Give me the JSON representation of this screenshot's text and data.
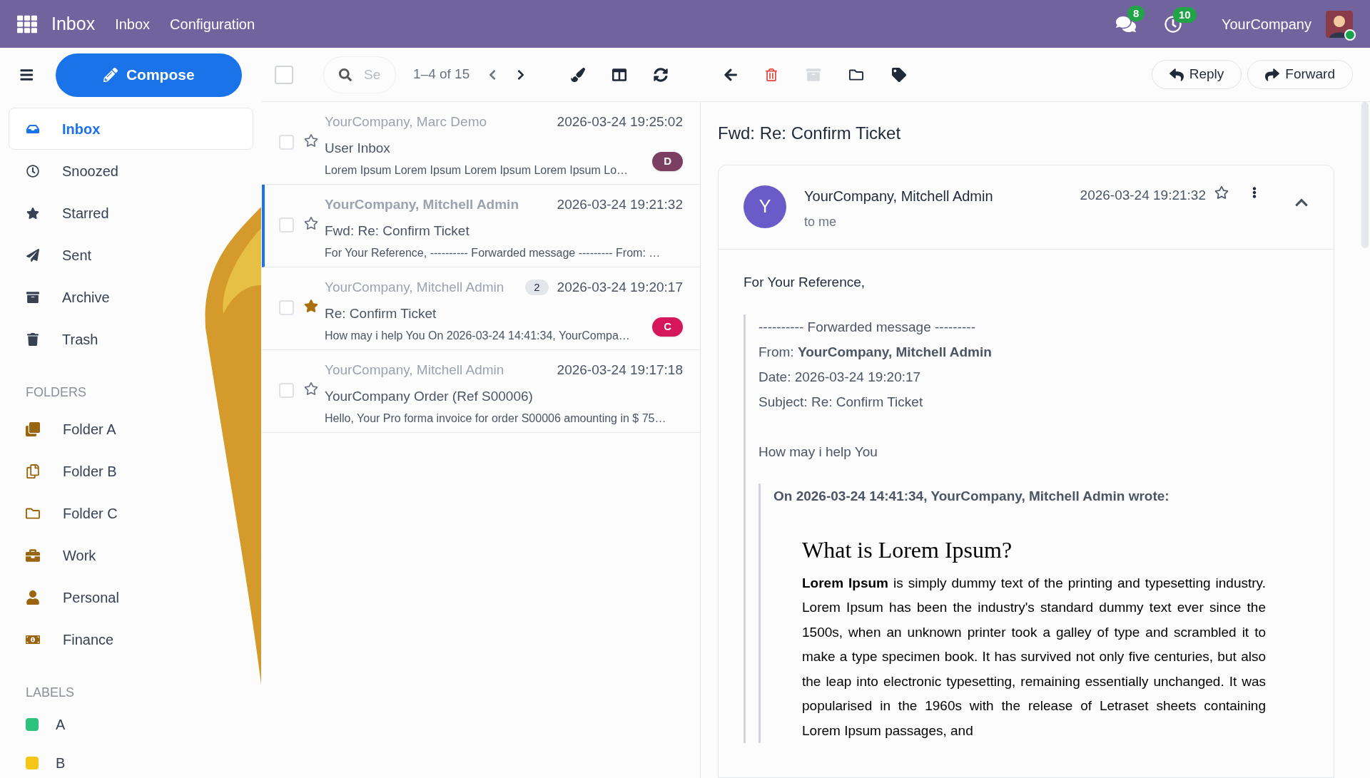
{
  "topbar": {
    "app": "Inbox",
    "menu": [
      "Inbox",
      "Configuration"
    ],
    "messages_badge": "8",
    "activities_badge": "10",
    "company": "YourCompany",
    "online": true
  },
  "toolbar": {
    "compose": "Compose",
    "select_all": {
      "checked": false
    },
    "search": {
      "placeholder": "Se"
    },
    "pager": "1–4 of 15",
    "reply": "Reply",
    "forward": "Forward"
  },
  "sidebar": {
    "mailboxes": [
      {
        "label": "Inbox",
        "selected": true
      },
      {
        "label": "Snoozed",
        "selected": false
      },
      {
        "label": "Starred",
        "selected": false
      },
      {
        "label": "Sent",
        "selected": false
      },
      {
        "label": "Archive",
        "selected": false
      },
      {
        "label": "Trash",
        "selected": false
      }
    ],
    "folders_heading": "FOLDERS",
    "folders": [
      {
        "label": "Folder A"
      },
      {
        "label": "Folder B"
      },
      {
        "label": "Folder C"
      },
      {
        "label": "Work"
      },
      {
        "label": "Personal"
      },
      {
        "label": "Finance"
      }
    ],
    "labels_heading": "LABELS",
    "labels": [
      {
        "label": "A",
        "color": "#2ec27e"
      },
      {
        "label": "B",
        "color": "#f5c518"
      }
    ]
  },
  "messages": [
    {
      "sender": "YourCompany, Marc Demo",
      "date": "2026-03-24 19:25:02",
      "subject": "User Inbox",
      "preview": "Lorem Ipsum Lorem Ipsum Lorem Ipsum Lorem Ipsum Lo…",
      "tag": "D",
      "color": "#7b3f61",
      "selected": false,
      "unread": false,
      "starred": false,
      "checked": false
    },
    {
      "sender": "YourCompany, Mitchell Admin",
      "date": "2026-03-24 19:21:32",
      "subject": "Fwd: Re: Confirm Ticket",
      "preview": "For Your Reference, ---------- Forwarded message --------- From: …",
      "selected": true,
      "unread": true,
      "starred": false,
      "checked": false
    },
    {
      "sender": "YourCompany, Mitchell Admin",
      "count": "2",
      "date": "2026-03-24 19:20:17",
      "subject": "Re: Confirm Ticket",
      "preview": "How may i help You On 2026-03-24 14:41:34, YourCompa…",
      "tag": "C",
      "color": "#d6165a",
      "selected": false,
      "unread": false,
      "starred": true,
      "checked": false
    },
    {
      "sender": "YourCompany, Mitchell Admin",
      "date": "2026-03-24 19:17:18",
      "subject": "YourCompany Order (Ref S00006)",
      "preview": "Hello, Your Pro forma invoice for order S00006 amounting in $ 75…",
      "selected": false,
      "unread": false,
      "starred": false,
      "checked": false
    }
  ],
  "reader": {
    "subject": "Fwd: Re: Confirm Ticket",
    "avatar": "Y",
    "sender": "YourCompany, Mitchell Admin",
    "recipient": "to me",
    "date": "2026-03-24 19:21:32",
    "starred": false,
    "greeting": "For Your Reference,",
    "forwarded": [
      "---------- Forwarded message ---------",
      "From: **YourCompany, Mitchell Admin**",
      "Date: 2026-03-24 19:20:17",
      "Subject: Re: Confirm Ticket"
    ],
    "reply": "How may i help You",
    "quote_header": "On 2026-03-24 14:41:34, YourCompany, Mitchell Admin wrote:",
    "quote_title": "What is Lorem Ipsum?",
    "quote_body": "**Lorem Ipsum** is simply dummy text of the printing and typesetting industry. Lorem Ipsum has been the industry's standard dummy text ever since the 1500s, when an unknown printer took a galley of type and scrambled it to make a type specimen book. It has survived not only five centuries, but also the leap into electronic typesetting, remaining essentially unchanged. It was popularised in the 1960s with the release of Letraset sheets containing Lorem Ipsum passages, and"
  }
}
